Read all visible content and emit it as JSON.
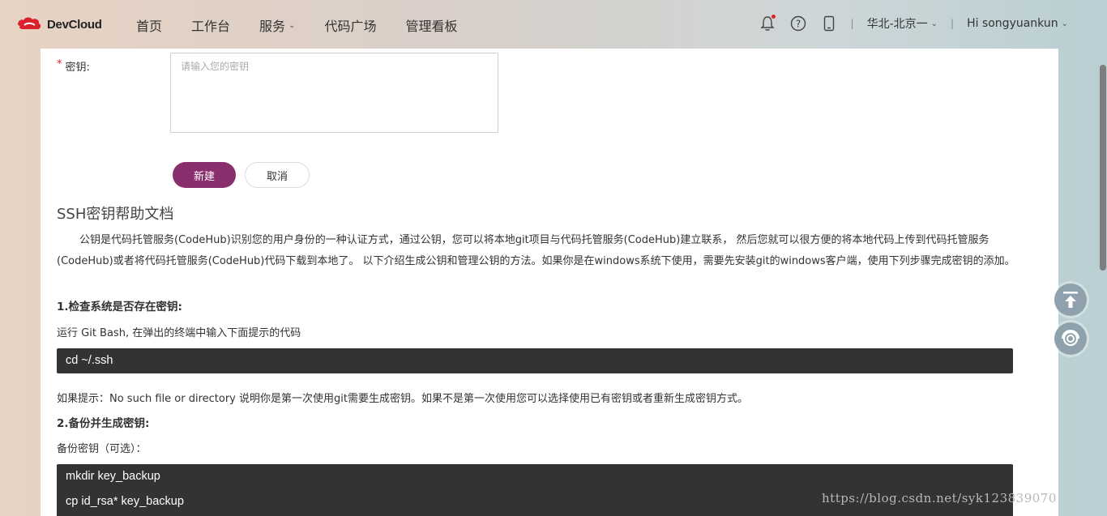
{
  "brand": {
    "name": "DevCloud"
  },
  "nav": {
    "items": [
      {
        "label": "首页",
        "has_dropdown": false
      },
      {
        "label": "工作台",
        "has_dropdown": false
      },
      {
        "label": "服务",
        "has_dropdown": true
      },
      {
        "label": "代码广场",
        "has_dropdown": false
      },
      {
        "label": "管理看板",
        "has_dropdown": false
      }
    ]
  },
  "header_tools": {
    "icons": [
      "bell-icon",
      "help-icon",
      "mobile-icon"
    ],
    "region": "华北-北京一",
    "user": "Hi songyuankun"
  },
  "form": {
    "key_label": "密钥:",
    "required_mark": "*",
    "key_placeholder": "请输入您的密钥",
    "key_value": "",
    "create_button": "新建",
    "cancel_button": "取消"
  },
  "doc": {
    "title": "SSH密钥帮助文档",
    "intro": "公钥是代码托管服务(CodeHub)识别您的用户身份的一种认证方式，通过公钥，您可以将本地git项目与代码托管服务(CodeHub)建立联系， 然后您就可以很方便的将本地代码上传到代码托管服务(CodeHub)或者将代码托管服务(CodeHub)代码下载到本地了。 以下介绍生成公钥和管理公钥的方法。如果你是在windows系统下使用，需要先安装git的windows客户端，使用下列步骤完成密钥的添加。",
    "step1_title": "1.检查系统是否存在密钥:",
    "step1_text": "运行 Git Bash, 在弹出的终端中输入下面提示的代码",
    "step1_code": [
      "cd ~/.ssh"
    ],
    "step1_hint": "如果提示：No such file or directory 说明你是第一次使用git需要生成密钥。如果不是第一次使用您可以选择使用已有密钥或者重新生成密钥方式。",
    "step2_title": "2.备份并生成密钥:",
    "step2_text": "备份密钥（可选）：",
    "step2_code": [
      "mkdir key_backup",
      "cp id_rsa* key_backup"
    ]
  },
  "watermark": "https://blog.csdn.net/syk123839070",
  "colors": {
    "primary": "#8b2e6e",
    "code_bg": "#333333",
    "required": "#e0241f"
  }
}
